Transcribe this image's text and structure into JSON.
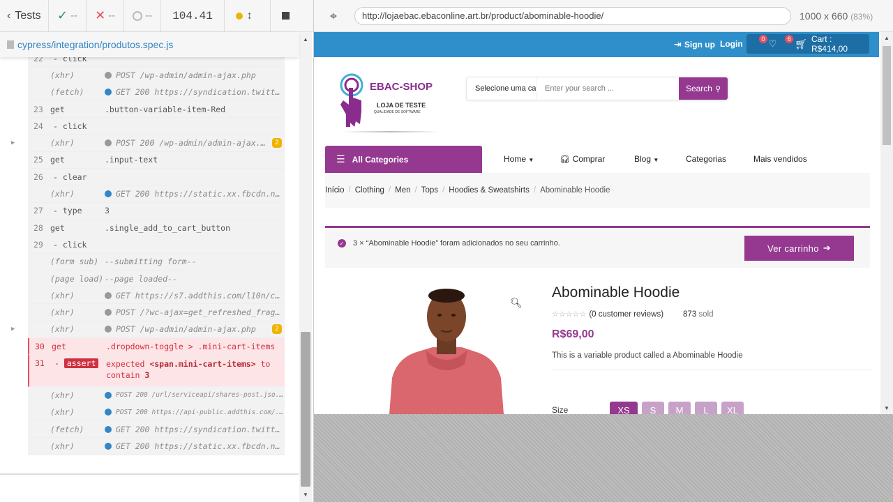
{
  "reporter": {
    "tests_label": "Tests",
    "passed": "--",
    "failed": "--",
    "pending": "--",
    "duration": "104.41",
    "spec_file": "cypress/integration/produtos.spec.js",
    "commands": [
      {
        "num": "22",
        "name": "- click",
        "msg": "",
        "type": "step"
      },
      {
        "num": "",
        "name": "(xhr)",
        "msg": "POST /wp-admin/admin-ajax.php",
        "type": "italic",
        "dot": "gray"
      },
      {
        "num": "",
        "name": "(fetch)",
        "msg": "GET 200 https://syndication.twitte...",
        "type": "italic",
        "dot": "blue"
      },
      {
        "num": "23",
        "name": "get",
        "msg": ".button-variable-item-Red",
        "type": "normal"
      },
      {
        "num": "24",
        "name": "- click",
        "msg": "",
        "type": "step"
      },
      {
        "num": "",
        "name": "(xhr)",
        "msg": "POST 200 /wp-admin/admin-ajax.p...",
        "type": "italic",
        "dot": "gray",
        "badge": "2",
        "caret": true
      },
      {
        "num": "25",
        "name": "get",
        "msg": ".input-text",
        "type": "normal"
      },
      {
        "num": "26",
        "name": "- clear",
        "msg": "",
        "type": "step"
      },
      {
        "num": "",
        "name": "(xhr)",
        "msg": "GET 200 https://static.xx.fbcdn.ne...",
        "type": "italic",
        "dot": "blue"
      },
      {
        "num": "27",
        "name": "- type",
        "msg": "3",
        "type": "step"
      },
      {
        "num": "28",
        "name": "get",
        "msg": ".single_add_to_cart_button",
        "type": "normal"
      },
      {
        "num": "29",
        "name": "- click",
        "msg": "",
        "type": "step"
      },
      {
        "num": "",
        "name": "(form sub)",
        "msg": "--submitting form--",
        "type": "italic"
      },
      {
        "num": "",
        "name": "(page load)",
        "msg": "--page loaded--",
        "type": "italic"
      },
      {
        "num": "",
        "name": "(xhr)",
        "msg": "GET https://s7.addthis.com/l10n/cl...",
        "type": "italic",
        "dot": "gray"
      },
      {
        "num": "",
        "name": "(xhr)",
        "msg": "POST /?wc-ajax=get_refreshed_fragm...",
        "type": "italic",
        "dot": "gray"
      },
      {
        "num": "",
        "name": "(xhr)",
        "msg": "POST /wp-admin/admin-ajax.php",
        "type": "italic",
        "dot": "gray",
        "badge": "2",
        "caret": true
      },
      {
        "num": "30",
        "name": "get",
        "msg": ".dropdown-toggle > .mini-cart-items",
        "type": "failed"
      },
      {
        "num": "31",
        "name": "assert",
        "msg": "",
        "type": "assert"
      },
      {
        "num": "",
        "name": "(xhr)",
        "msg": "POST 200 /url/serviceapi/shares-post.jso...",
        "type": "italic-small",
        "dot": "blue"
      },
      {
        "num": "",
        "name": "(xhr)",
        "msg": "POST 200 https://api-public.addthis.com/...",
        "type": "italic-small",
        "dot": "blue"
      },
      {
        "num": "",
        "name": "(fetch)",
        "msg": "GET 200 https://syndication.twitte...",
        "type": "italic",
        "dot": "blue"
      },
      {
        "num": "",
        "name": "(xhr)",
        "msg": "GET 200 https://static.xx.fbcdn.ne...",
        "type": "italic",
        "dot": "blue"
      }
    ],
    "assert_parts": {
      "expected": "expected",
      "subject": "<span.mini-cart-items>",
      "to": "to",
      "contain": "contain",
      "value": "3"
    }
  },
  "aut": {
    "url": "http://lojaebac.ebaconline.art.br/product/abominable-hoodie/",
    "viewport": "1000 x 660",
    "zoom": "(83%)"
  },
  "site": {
    "signup": "Sign up",
    "login": "Login",
    "wishlist_count": "0",
    "cart_count": "6",
    "cart_label": "Cart : R$414,00",
    "logo_title": "EBAC-SHOP",
    "logo_sub": "LOJA DE TESTE",
    "logo_sub2": "QUALIDADE DE SOFTWARE",
    "search_category": "Selecione uma cat",
    "search_placeholder": "Enter your search ...",
    "search_button": "Search",
    "all_categories": "All Categories",
    "nav": [
      "Home",
      "Comprar",
      "Blog",
      "Categorias",
      "Mais vendidos"
    ],
    "breadcrumb": [
      "Início",
      "Clothing",
      "Men",
      "Tops",
      "Hoodies & Sweatshirts",
      "Abominable Hoodie"
    ],
    "notice_text": "3 × “Abominable Hoodie” foram adicionados no seu carrinho.",
    "notice_button": "Ver carrinho",
    "product": {
      "title": "Abominable Hoodie",
      "reviews": "(0 customer reviews)",
      "sold_count": "873",
      "sold_label": "sold",
      "price": "R$69,00",
      "description": "This is a variable product called a Abominable Hoodie",
      "size_label": "Size",
      "sizes": [
        "XS",
        "S",
        "M",
        "L",
        "XL"
      ],
      "selected_size": "XS"
    }
  }
}
